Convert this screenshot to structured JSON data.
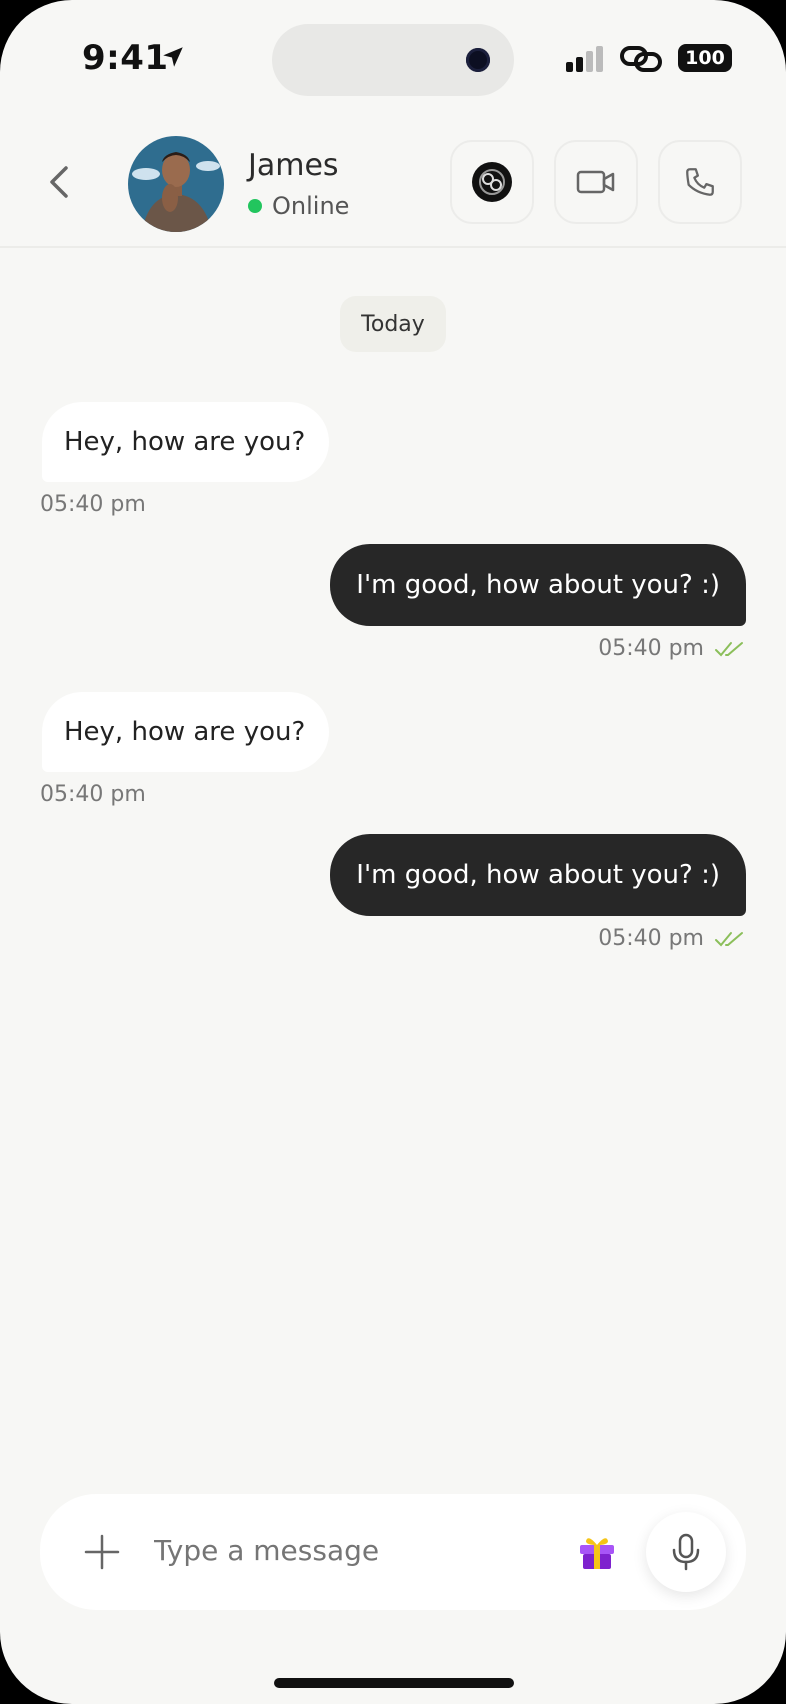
{
  "status_bar": {
    "time": "9:41",
    "battery": "100"
  },
  "header": {
    "contact_name": "James",
    "presence": "Online",
    "actions": [
      "sticker-icon",
      "video-call-icon",
      "phone-call-icon"
    ]
  },
  "chat": {
    "date_separator": "Today",
    "messages": [
      {
        "direction": "in",
        "text": "Hey, how are you?",
        "time": "05:40 pm"
      },
      {
        "direction": "out",
        "text": "I'm good, how about you? :)",
        "time": "05:40 pm",
        "read": true
      },
      {
        "direction": "in",
        "text": "Hey, how are you?",
        "time": "05:40 pm"
      },
      {
        "direction": "out",
        "text": "I'm good, how about you? :)",
        "time": "05:40 pm",
        "read": true
      }
    ]
  },
  "composer": {
    "placeholder": "Type a message",
    "gift_icon": "gift-icon",
    "mic_icon": "mic-icon"
  },
  "colors": {
    "online": "#22c55e",
    "outgoing_bubble": "#272727",
    "read_ticks": "#8bbf5a"
  }
}
